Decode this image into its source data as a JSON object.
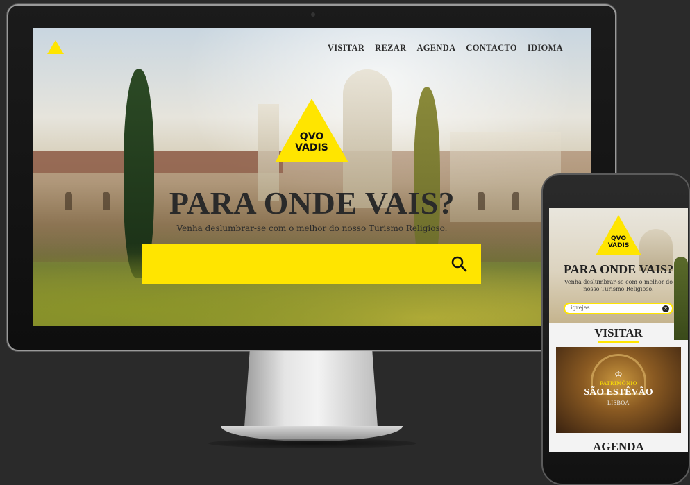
{
  "desktop": {
    "nav": [
      "VISITAR",
      "REZAR",
      "AGENDA",
      "CONTACTO",
      "IDIOMA"
    ],
    "logo": {
      "line1": "QVO",
      "line2": "VADIS"
    },
    "heading": "PARA ONDE VAIS?",
    "subtitle": "Venha deslumbrar-se com o melhor do nosso Turismo Religioso.",
    "search_value": "",
    "accent": "#ffe500"
  },
  "mobile": {
    "logo": {
      "line1": "QVO",
      "line2": "VADIS"
    },
    "heading": "PARA ONDE VAIS?",
    "subtitle": "Venha deslumbrar-se com o melhor do nosso  Turismo Religioso.",
    "search_value": "igrejas",
    "section_visitar": "VISITAR",
    "card": {
      "tag": "PATRIMÓNIO",
      "title": "SÃO ESTÊVÃO",
      "place": "LISBOA"
    },
    "section_agenda": "AGENDA"
  },
  "icons": [
    "triangle-logo-icon",
    "search-icon",
    "clear-icon",
    "crown-icon"
  ]
}
